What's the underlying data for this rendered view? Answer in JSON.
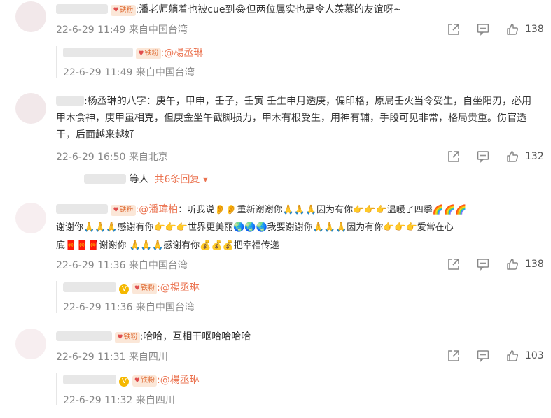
{
  "comments": [
    {
      "fan_label": "铁粉",
      "text": ":潘老师躺着也被cue到😂但两位属实也是令人羡慕的友谊呀~",
      "time": "22-6-29 11:49",
      "source": "来自中国台湾",
      "likes": "138",
      "reply": {
        "fan_label": "铁粉",
        "mention": ":@楊丞琳",
        "time": "22-6-29 11:49",
        "source": "来自中国台湾"
      }
    },
    {
      "text": ":杨丞琳的八字：庚午，甲申，壬子，壬寅 壬生申月透庚，偏印格，原局壬火当令受生，自坐阳刃，必用甲木食神，庚甲虽相克，但庚金坐午截脚损力，甲木有根受生，用神有辅，手段可见非常，格局贵重。伤官透干，后面越来越好",
      "time": "22-6-29 16:50",
      "source": "来自北京",
      "likes": "132",
      "replies_who": "等人",
      "replies_more": "共6条回复"
    },
    {
      "fan_label": "铁粉",
      "mention": ":@潘瑋柏",
      "text_1": "：听我说👂👂重新谢谢你🙏🙏🙏因为有你👉👉👉温暖了四季🌈🌈🌈",
      "text_2": "谢谢你🙏🙏🙏感谢有你👉👉👉世界更美丽🌏🌏🌏我要谢谢你🙏🙏🙏因为有你👉👉👉爱常在心",
      "text_3": "底🧧🧧🧧谢谢你 🙏🙏🙏感谢有你💰💰💰把幸福传递",
      "time": "22-6-29 11:36",
      "source": "来自中国台湾",
      "likes": "138",
      "reply": {
        "fan_label": "铁粉",
        "mention": ":@楊丞琳",
        "time": "22-6-29 11:36",
        "source": "来自中国台湾"
      }
    },
    {
      "fan_label": "铁粉",
      "text": ":哈哈，互相干呕哈哈哈哈",
      "time": "22-6-29 11:31",
      "source": "来自四川",
      "likes": "103",
      "reply": {
        "fan_label": "铁粉",
        "mention": ":@楊丞琳",
        "time": "22-6-29 11:32",
        "source": "来自四川"
      }
    }
  ],
  "icons": {
    "share": "share-icon",
    "comment": "comment-icon",
    "like": "thumbs-up-icon",
    "verified": "verified-badge-icon",
    "fan": "fan-heart-icon"
  },
  "colors": {
    "link": "#eb7350",
    "meta": "#888888",
    "fan_badge_bg": "#fbe7d8"
  }
}
